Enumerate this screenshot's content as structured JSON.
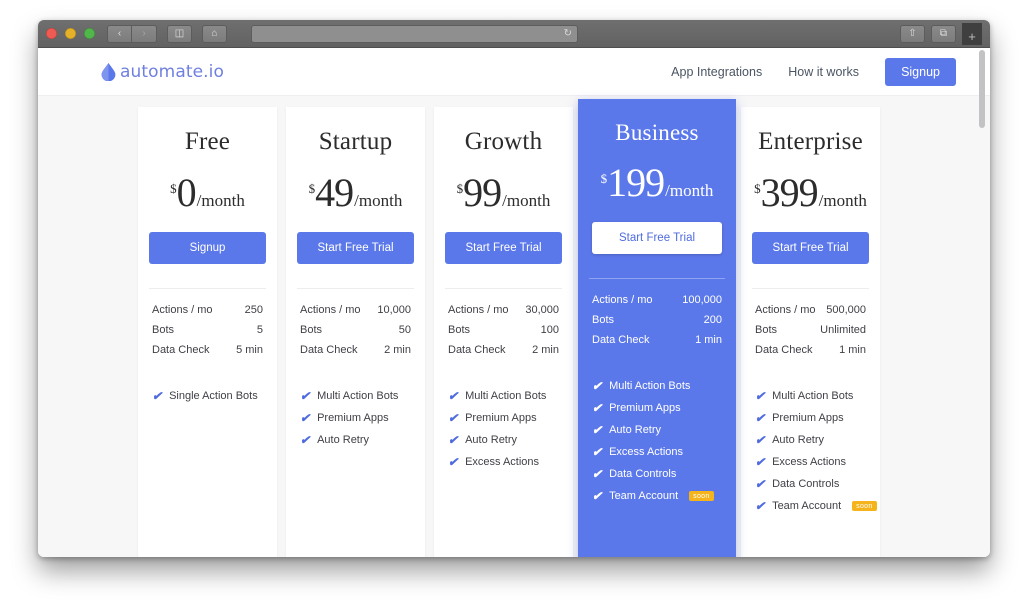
{
  "browser": {
    "traffic_lights": [
      "close",
      "minimize",
      "zoom"
    ],
    "back_label": "‹",
    "forward_label": "›",
    "sidebar_label": "◫",
    "home_label": "⌂",
    "address_value": "",
    "address_placeholder": "",
    "reload_label": "↻",
    "share_label": "⇧",
    "tabs_label": "⧉",
    "new_tab_label": "+"
  },
  "site": {
    "logo_text": "automate.io",
    "nav": [
      {
        "label": "App Integrations"
      },
      {
        "label": "How it works"
      }
    ],
    "signup_label": "Signup"
  },
  "pricing": {
    "plans": [
      {
        "name": "Free",
        "currency": "$",
        "amount": "0",
        "period": "/month",
        "cta": "Signup",
        "featured": false,
        "stats": [
          {
            "label": "Actions / mo",
            "value": "250"
          },
          {
            "label": "Bots",
            "value": "5"
          },
          {
            "label": "Data Check",
            "value": "5 min"
          }
        ],
        "features": [
          {
            "label": "Single Action Bots",
            "badge": ""
          }
        ]
      },
      {
        "name": "Startup",
        "currency": "$",
        "amount": "49",
        "period": "/month",
        "cta": "Start Free Trial",
        "featured": false,
        "stats": [
          {
            "label": "Actions / mo",
            "value": "10,000"
          },
          {
            "label": "Bots",
            "value": "50"
          },
          {
            "label": "Data Check",
            "value": "2 min"
          }
        ],
        "features": [
          {
            "label": "Multi Action Bots",
            "badge": ""
          },
          {
            "label": "Premium Apps",
            "badge": ""
          },
          {
            "label": "Auto Retry",
            "badge": ""
          }
        ]
      },
      {
        "name": "Growth",
        "currency": "$",
        "amount": "99",
        "period": "/month",
        "cta": "Start Free Trial",
        "featured": false,
        "stats": [
          {
            "label": "Actions / mo",
            "value": "30,000"
          },
          {
            "label": "Bots",
            "value": "100"
          },
          {
            "label": "Data Check",
            "value": "2 min"
          }
        ],
        "features": [
          {
            "label": "Multi Action Bots",
            "badge": ""
          },
          {
            "label": "Premium Apps",
            "badge": ""
          },
          {
            "label": "Auto Retry",
            "badge": ""
          },
          {
            "label": "Excess Actions",
            "badge": ""
          }
        ]
      },
      {
        "name": "Business",
        "currency": "$",
        "amount": "199",
        "period": "/month",
        "cta": "Start Free Trial",
        "featured": true,
        "stats": [
          {
            "label": "Actions / mo",
            "value": "100,000"
          },
          {
            "label": "Bots",
            "value": "200"
          },
          {
            "label": "Data Check",
            "value": "1 min"
          }
        ],
        "features": [
          {
            "label": "Multi Action Bots",
            "badge": ""
          },
          {
            "label": "Premium Apps",
            "badge": ""
          },
          {
            "label": "Auto Retry",
            "badge": ""
          },
          {
            "label": "Excess Actions",
            "badge": ""
          },
          {
            "label": "Data Controls",
            "badge": ""
          },
          {
            "label": "Team Account",
            "badge": "soon"
          }
        ]
      },
      {
        "name": "Enterprise",
        "currency": "$",
        "amount": "399",
        "period": "/month",
        "cta": "Start Free Trial",
        "featured": false,
        "stats": [
          {
            "label": "Actions / mo",
            "value": "500,000"
          },
          {
            "label": "Bots",
            "value": "Unlimited"
          },
          {
            "label": "Data Check",
            "value": "1 min"
          }
        ],
        "features": [
          {
            "label": "Multi Action Bots",
            "badge": ""
          },
          {
            "label": "Premium Apps",
            "badge": ""
          },
          {
            "label": "Auto Retry",
            "badge": ""
          },
          {
            "label": "Excess Actions",
            "badge": ""
          },
          {
            "label": "Data Controls",
            "badge": ""
          },
          {
            "label": "Team Account",
            "badge": "soon"
          }
        ]
      }
    ],
    "check_glyph": "✔"
  },
  "colors": {
    "accent": "#5b78ea",
    "badge": "#f5b31c",
    "page_bg": "#f7f7f8"
  }
}
